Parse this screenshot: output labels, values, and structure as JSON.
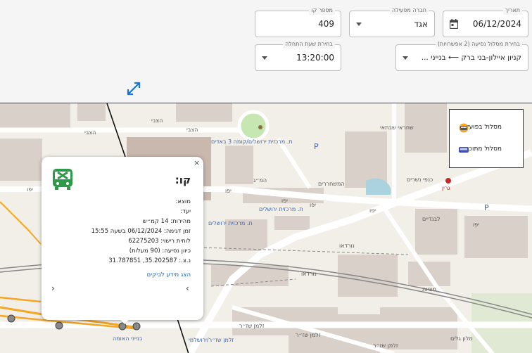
{
  "form": {
    "date": {
      "label": "תאריך",
      "value": "06/12/2024"
    },
    "operator": {
      "label": "חברה מפעילה",
      "value": "אגד"
    },
    "line_number": {
      "label": "מספר קו",
      "value": "409"
    },
    "route": {
      "label": "בחירת מסלול נסיעה (2 אפשרויות)",
      "value": "קניון איילון-בני ברק ⟵ בנייני ..."
    },
    "start_time": {
      "label": "בחירת שעת התחלה",
      "value": "13:20:00"
    }
  },
  "legend": {
    "actual": "מסלול בפועל",
    "planned": "מסלול מתוכנן"
  },
  "popup": {
    "title": "קו:",
    "origin": "מוצא:",
    "destination": "יעד:",
    "speed": "מהירות: 14 קמ״ש",
    "sample_time": "זמן דגימה: 06/12/2024 בשעה 15:55",
    "license_plate": "לוחית רישוי: 62275203",
    "direction": "כיוון נסיעה: (90 מעלות)",
    "coords": "נ.צ.: 35.202587, 31.787851",
    "show_more": "הצג מידע לביקים",
    "prev": "‹",
    "next": "›",
    "close": "×"
  },
  "map_labels": {
    "hazvi_1": "הצבי",
    "hazvi_2": "הצבי",
    "hazvi_3": "הצבי",
    "yafo_1": "יפו",
    "yafo_2": "יפו",
    "yafo_3": "יפו",
    "yafo_4": "יפו",
    "yafo_5": "יפו",
    "yafo_6": "יפו",
    "nordau_1": "נורדאו",
    "nordau_2": "נורדאו",
    "zalman_1": "זלמן שז״ר",
    "zalman_2": "זלמן שז״ר",
    "zalman_3": "זלמן שז״ר",
    "hamem_gimel": "המ״ג",
    "hameshachrerim": "המשחררים",
    "kanfei_nesharim": "כנפי נשרים",
    "shachrai_shabtai": "שחראי שבתאי",
    "shazar_stop": "ת. מרכזית ירושלים/קומה 3 באדים",
    "central_1": "ת. מרכזית ירושלים",
    "central_2": "ת. מרכזית ירושלים",
    "shazar_bottom": "בנייני האומה",
    "shazar_bottom2": "זלמן שז״ר/ירושלמי",
    "galey_tz": "מלון גלים",
    "grin": "גרין",
    "yad_1": "לבנדיים",
    "taxi": "מוניות"
  },
  "colors": {
    "accent": "#1976d2",
    "bus_green": "#2e9a4a",
    "actual_route": "#f5a623",
    "planned_route": "#3f51b5"
  }
}
